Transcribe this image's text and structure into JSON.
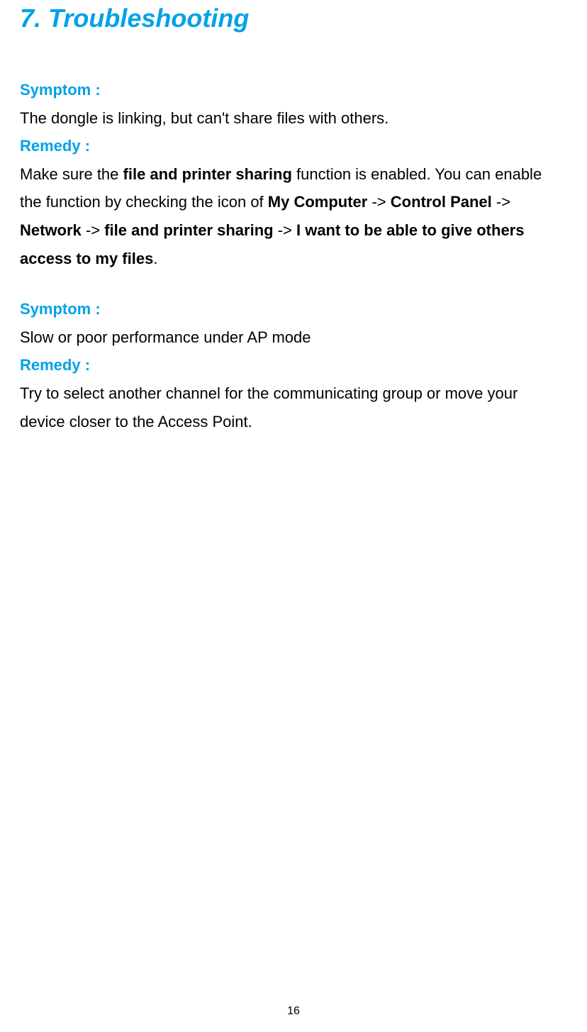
{
  "title": "7. Troubleshooting",
  "sections": [
    {
      "symptom_label": "Symptom :",
      "symptom_text": "The dongle is linking, but can't share files with others.",
      "remedy_label": "Remedy :",
      "remedy_parts": {
        "pre1": "Make sure the ",
        "b1": "file and printer sharing",
        "pre2": " function is enabled. You can enable the function by checking the icon of ",
        "b2": "My Computer",
        "sep1": " -> ",
        "b3": "Control Panel",
        "sep2": " -> ",
        "b4": "Network",
        "sep3": " -> ",
        "b5": "file and printer sharing",
        "sep4": " -> ",
        "b6": "I want to be able to give others access to my files",
        "end": "."
      }
    },
    {
      "symptom_label": "Symptom :",
      "symptom_text": "Slow or poor performance under AP mode",
      "remedy_label": "Remedy :",
      "remedy_text": "Try to select another channel for the communicating group or move your device closer to the Access Point."
    }
  ],
  "page_number": "16"
}
